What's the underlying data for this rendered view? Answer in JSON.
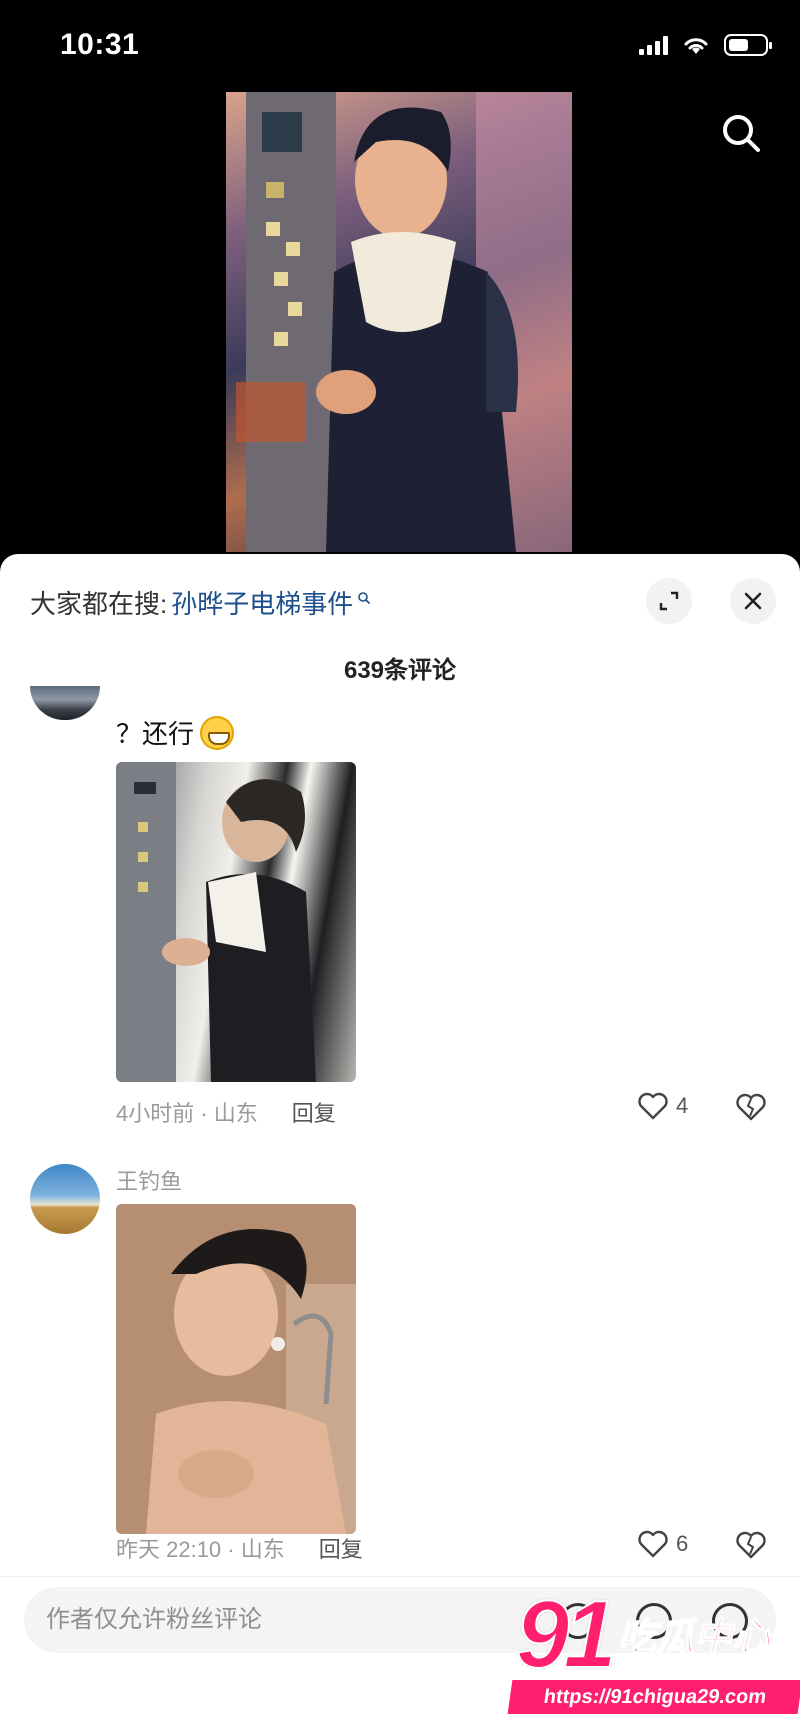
{
  "status_bar": {
    "time": "10:31",
    "battery_level": 0.55
  },
  "icons": {
    "search": "search-icon",
    "expand": "expand-icon",
    "close": "close-icon",
    "like": "heart-icon",
    "dislike": "broken-heart-icon",
    "emoji": "grinning-emoji-icon"
  },
  "sheet": {
    "hot_search_prefix": "大家都在搜:",
    "hot_search_term": "孙晔子电梯事件",
    "comment_count": "639条评论"
  },
  "comments": [
    {
      "username": "",
      "text": "？还行",
      "time_location": "4小时前 · 山东",
      "reply_label": "回复",
      "likes": "4"
    },
    {
      "username": "王钓鱼",
      "text": "",
      "time_location": "昨天 22:10 · 山东",
      "reply_label": "回复",
      "likes": "6"
    }
  ],
  "input": {
    "placeholder": "作者仅允许粉丝评论"
  },
  "watermark": {
    "number": "91",
    "name": "吃瓜中心",
    "url": "https://91chigua29.com"
  },
  "colors": {
    "accent_link": "#1c4f8c",
    "watermark": "#ff1f6e"
  }
}
